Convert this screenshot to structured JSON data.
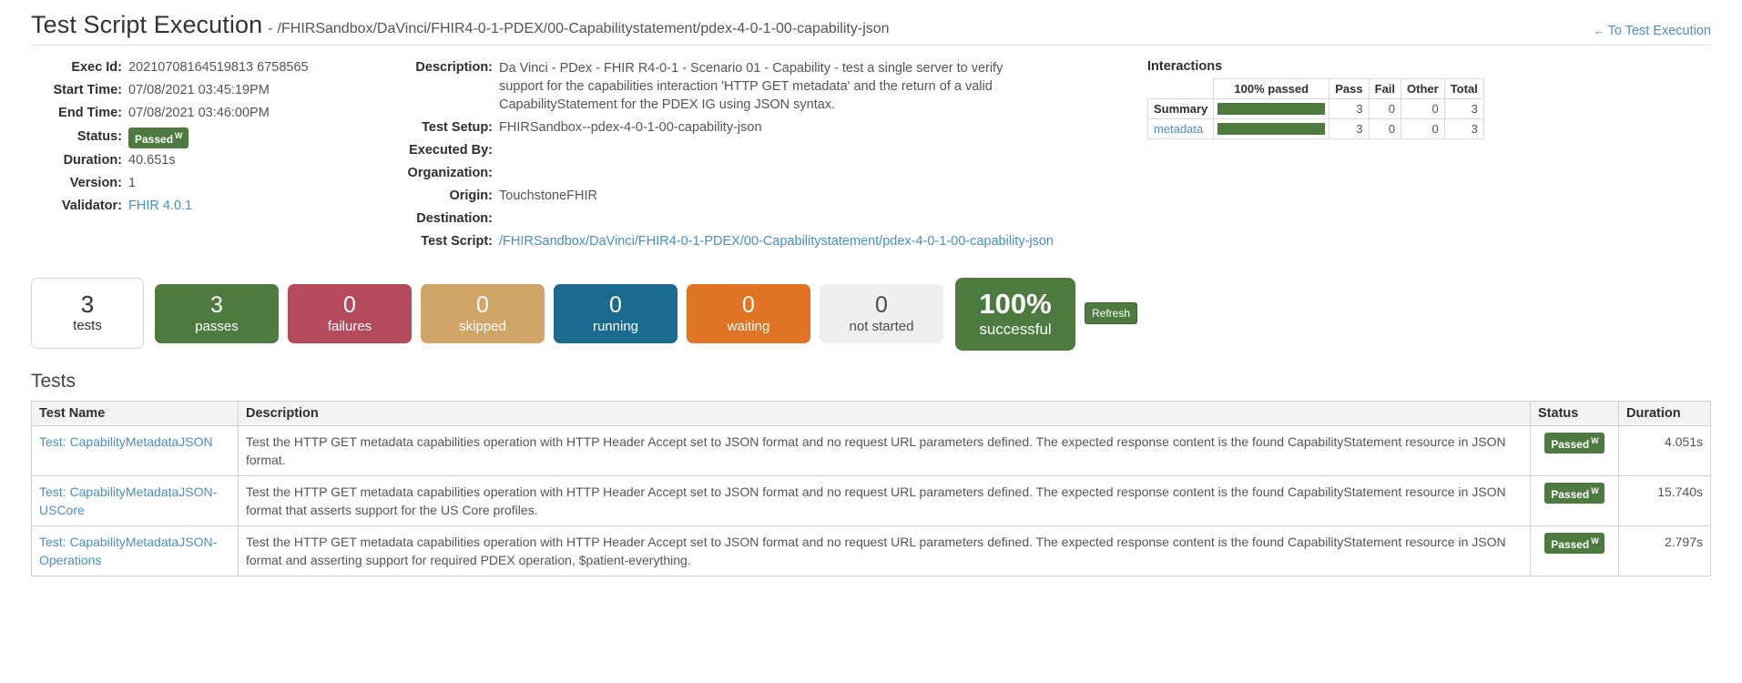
{
  "header": {
    "title": "Test Script Execution",
    "separator": "-",
    "subtitle": "/FHIRSandbox/DaVinci/FHIR4-0-1-PDEX/00-Capabilitystatement/pdex-4-0-1-00-capability-json",
    "back_link": "To Test Execution",
    "back_arrow": "←"
  },
  "details_left": {
    "exec_id_label": "Exec Id:",
    "exec_id": "20210708164519813 6758565",
    "start_time_label": "Start Time:",
    "start_time": "07/08/2021 03:45:19PM",
    "end_time_label": "End Time:",
    "end_time": "07/08/2021 03:46:00PM",
    "status_label": "Status:",
    "status": "Passed",
    "status_sup": "W",
    "duration_label": "Duration:",
    "duration": "40.651s",
    "version_label": "Version:",
    "version": "1",
    "validator_label": "Validator:",
    "validator": "FHIR 4.0.1"
  },
  "details_mid": {
    "description_label": "Description:",
    "description": "Da Vinci - PDex - FHIR R4-0-1 - Scenario 01 - Capability - test a single server to verify support for the capabilities interaction 'HTTP GET metadata' and the return of a valid CapabilityStatement for the PDEX IG using JSON syntax.",
    "test_setup_label": "Test Setup:",
    "test_setup": "FHIRSandbox--pdex-4-0-1-00-capability-json",
    "executed_by_label": "Executed By:",
    "executed_by": "",
    "organization_label": "Organization:",
    "organization": "",
    "origin_label": "Origin:",
    "origin": "TouchstoneFHIR",
    "destination_label": "Destination:",
    "destination": "",
    "test_script_label": "Test Script:",
    "test_script": "/FHIRSandbox/DaVinci/FHIR4-0-1-PDEX/00-Capabilitystatement/pdex-4-0-1-00-capability-json"
  },
  "interactions": {
    "title": "Interactions",
    "columns": [
      "",
      "100% passed",
      "Pass",
      "Fail",
      "Other",
      "Total"
    ],
    "rows": [
      {
        "label": "Summary",
        "is_link": false,
        "percent": 100,
        "pass": "3",
        "fail": "0",
        "other": "0",
        "total": "3"
      },
      {
        "label": "metadata",
        "is_link": true,
        "percent": 100,
        "pass": "3",
        "fail": "0",
        "other": "0",
        "total": "3"
      }
    ]
  },
  "tiles": [
    {
      "num": "3",
      "label": "tests"
    },
    {
      "num": "3",
      "label": "passes"
    },
    {
      "num": "0",
      "label": "failures"
    },
    {
      "num": "0",
      "label": "skipped"
    },
    {
      "num": "0",
      "label": "running"
    },
    {
      "num": "0",
      "label": "waiting"
    },
    {
      "num": "0",
      "label": "not started"
    }
  ],
  "success_tile": {
    "num": "100%",
    "label": "successful"
  },
  "refresh_label": "Refresh",
  "tests_section": {
    "heading": "Tests",
    "columns": [
      "Test Name",
      "Description",
      "Status",
      "Duration"
    ],
    "rows": [
      {
        "name": "Test: CapabilityMetadataJSON",
        "description": "Test the HTTP GET metadata capabilities operation with HTTP Header Accept set to JSON format and no request URL parameters defined. The expected response content is the found CapabilityStatement resource in JSON format.",
        "status": "Passed",
        "status_sup": "W",
        "duration": "4.051s"
      },
      {
        "name": "Test: CapabilityMetadataJSON-USCore",
        "description": "Test the HTTP GET metadata capabilities operation with HTTP Header Accept set to JSON format and no request URL parameters defined. The expected response content is the found CapabilityStatement resource in JSON format that asserts support for the US Core profiles.",
        "status": "Passed",
        "status_sup": "W",
        "duration": "15.740s"
      },
      {
        "name": "Test: CapabilityMetadataJSON-Operations",
        "description": "Test the HTTP GET metadata capabilities operation with HTTP Header Accept set to JSON format and no request URL parameters defined. The expected response content is the found CapabilityStatement resource in JSON format and asserting support for required PDEX operation, $patient-everything.",
        "status": "Passed",
        "status_sup": "W",
        "duration": "2.797s"
      }
    ]
  },
  "colors": {
    "passed_green": "#4c7a3f",
    "failures_red": "#b54a5c",
    "skipped_tan": "#d0a567",
    "running_blue": "#1b6a90",
    "waiting_orange": "#df7424",
    "not_started_gray": "#f0efef",
    "link_blue": "#4a8ec2"
  }
}
